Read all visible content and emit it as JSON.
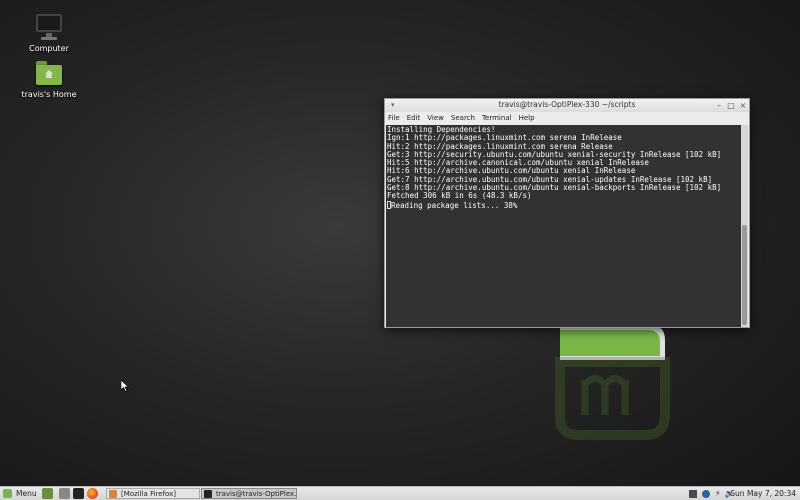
{
  "desktop": {
    "icons": [
      {
        "label": "Computer",
        "icon": "computer-icon"
      },
      {
        "label": "travis's Home",
        "icon": "home-folder-icon"
      }
    ]
  },
  "terminal": {
    "title": "travis@travis-OptiPlex-330 ~/scripts",
    "menu": [
      "File",
      "Edit",
      "View",
      "Search",
      "Terminal",
      "Help"
    ],
    "lines": [
      "Installing Dependencies!",
      "Ign:1 http://packages.linuxmint.com serena InRelease",
      "Hit:2 http://packages.linuxmint.com serena Release",
      "Get:3 http://security.ubuntu.com/ubuntu xenial-security InRelease [102 kB]",
      "Hit:5 http://archive.canonical.com/ubuntu xenial InRelease",
      "Hit:6 http://archive.ubuntu.com/ubuntu xenial InRelease",
      "Get:7 http://archive.ubuntu.com/ubuntu xenial-updates InRelease [102 kB]",
      "Get:8 http://archive.ubuntu.com/ubuntu xenial-backports InRelease [102 kB]",
      "Fetched 306 kB in 6s (48.3 kB/s)",
      "Reading package lists... 38%"
    ],
    "controls": {
      "minimize": "–",
      "maximize": "□",
      "close": "×"
    }
  },
  "panel": {
    "menu_label": "Menu",
    "tasks": [
      {
        "label": "[Mozilla Firefox]",
        "active": false
      },
      {
        "label": "travis@travis-OptiPlex...",
        "active": true
      }
    ],
    "clock": "Sun May 7, 20:34"
  },
  "colors": {
    "accent": "#7ab648",
    "terminal_bg": "#323232"
  }
}
